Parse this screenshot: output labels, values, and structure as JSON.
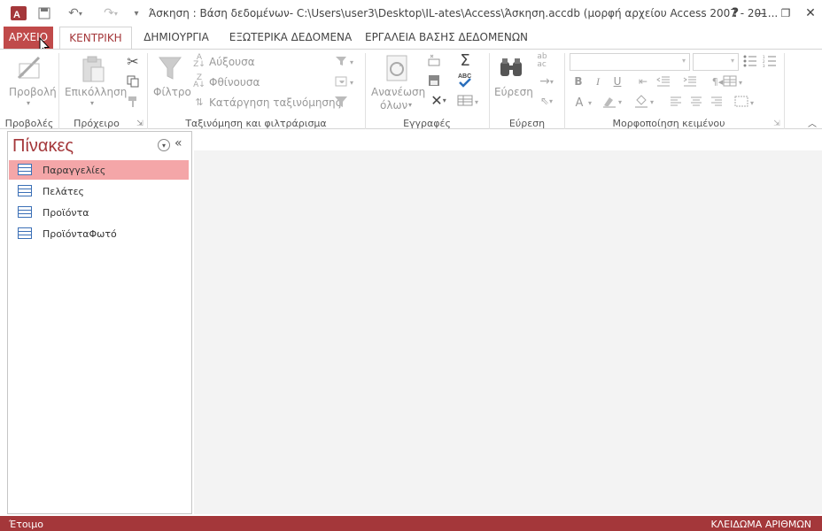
{
  "window": {
    "title": "Άσκηση : Βάση δεδομένων- C:\\Users\\user3\\Desktop\\IL-ates\\Access\\Άσκηση.accdb (μορφή αρχείου Access 2007 - 201...",
    "help": "?",
    "minimize": "—",
    "restore": "❐",
    "close": "✕"
  },
  "tabs": [
    "ΑΡΧΕΙΟ",
    "ΚΕΝΤΡΙΚΗ",
    "ΔΗΜΙΟΥΡΓΙΑ",
    "ΕΞΩΤΕΡΙΚΑ ΔΕΔΟΜΕΝΑ",
    "ΕΡΓΑΛΕΙΑ ΒΑΣΗΣ ΔΕΔΟΜΕΝΩΝ"
  ],
  "ribbon": {
    "groups": {
      "views": "Προβολές",
      "clipboard": "Πρόχειρο",
      "sort": "Ταξινόμηση και φιλτράρισμα",
      "records": "Εγγραφές",
      "find": "Εύρεση",
      "format": "Μορφοποίηση κειμένου"
    },
    "view_label": "Προβολή",
    "paste_label": "Επικόλληση",
    "filter_label": "Φίλτρο",
    "ascending": "Αύξουσα",
    "descending": "Φθίνουσα",
    "remove_sort": "Κατάργηση ταξινόμησης",
    "refresh_label_1": "Ανανέωση",
    "refresh_label_2": "όλων",
    "find_label": "Εύρεση",
    "bold": "B",
    "italic": "I",
    "underline": "U",
    "font_color": "A"
  },
  "nav": {
    "title": "Πίνακες",
    "items": [
      "Παραγγελίες",
      "Πελάτες",
      "Προϊόντα",
      "ΠροϊόνταΦωτό"
    ],
    "selected_index": 0
  },
  "status": {
    "left": "Έτοιμο",
    "right": "ΚΛΕΙΔΩΜΑ ΑΡΙΘΜΩΝ"
  },
  "colors": {
    "accent": "#a4373a",
    "selected_item": "#f4a6a8"
  }
}
